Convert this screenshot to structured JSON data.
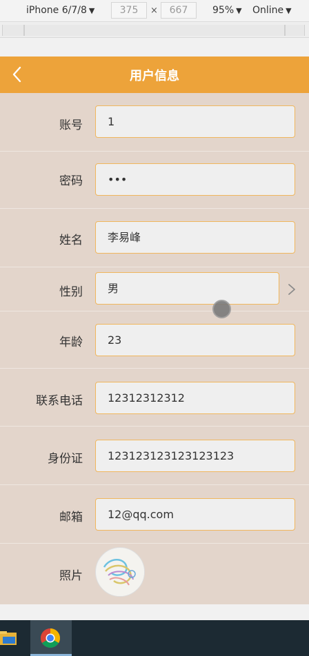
{
  "devtools": {
    "device": "iPhone 6/7/8",
    "width": "375",
    "height": "667",
    "times": "×",
    "zoom": "95%",
    "network": "Online",
    "arrow": "▼"
  },
  "header": {
    "title": "用户信息",
    "back_icon": "chevron-left-icon",
    "color": "#eda33a"
  },
  "form": {
    "account": {
      "label": "账号",
      "value": "1"
    },
    "password": {
      "label": "密码",
      "value": "•••"
    },
    "name": {
      "label": "姓名",
      "value": "李易峰"
    },
    "gender": {
      "label": "性别",
      "value": "男"
    },
    "age": {
      "label": "年龄",
      "value": "23"
    },
    "phone": {
      "label": "联系电话",
      "value": "12312312312"
    },
    "id_card": {
      "label": "身份证",
      "value": "123123123123123123"
    },
    "email": {
      "label": "邮箱",
      "value": "12@qq.com"
    },
    "photo": {
      "label": "照片"
    }
  },
  "colors": {
    "accent": "#eda33a",
    "background": "#e3d5cb",
    "field_border": "#f0b65c"
  }
}
